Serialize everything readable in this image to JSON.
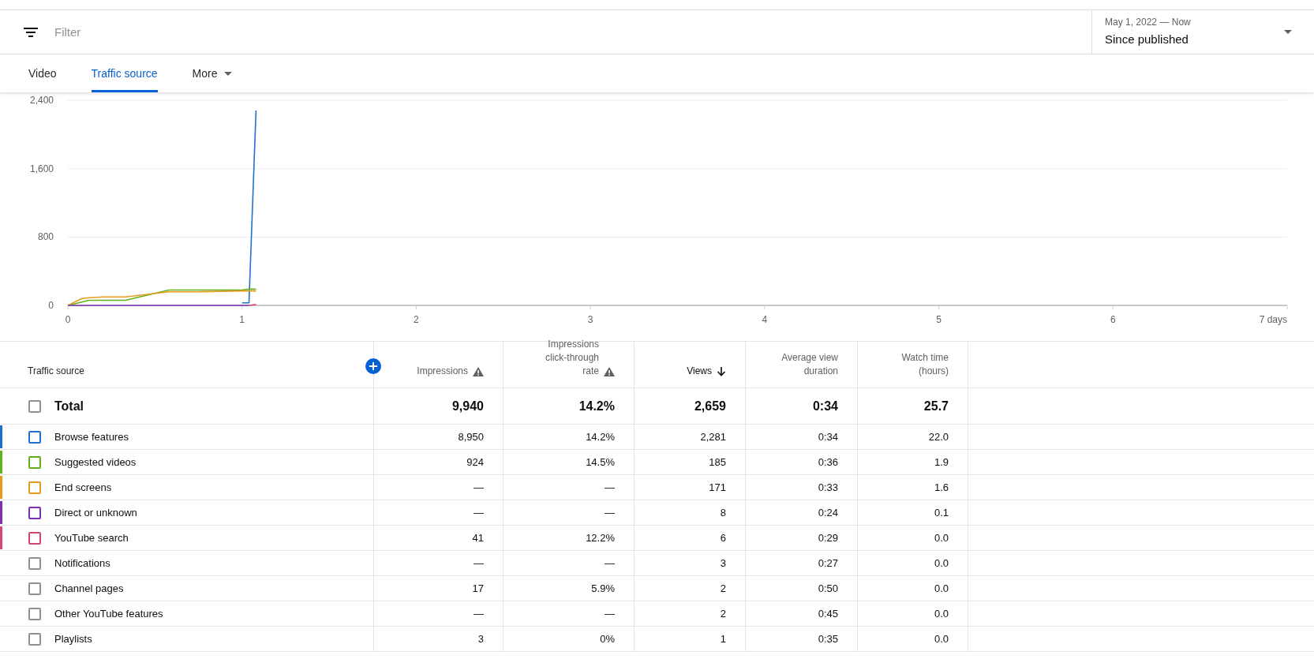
{
  "filter": {
    "placeholder": "Filter"
  },
  "date_range": {
    "range": "May 1, 2022 — Now",
    "label": "Since published"
  },
  "tabs": [
    {
      "label": "Video",
      "kind": "tab",
      "selected": false
    },
    {
      "label": "Traffic source",
      "kind": "tab",
      "selected": true
    },
    {
      "label": "More",
      "kind": "menu",
      "selected": false
    }
  ],
  "chart": {
    "chart_data": {
      "type": "line",
      "x": [
        0,
        0.08,
        0.12,
        0.2,
        0.33,
        0.58,
        0.75,
        1.0,
        1.04,
        1.08
      ],
      "series": [
        {
          "color": "#1f6fd1",
          "values": [
            null,
            null,
            null,
            null,
            null,
            null,
            null,
            30,
            30,
            2280
          ]
        },
        {
          "color": "#64b01a",
          "values": [
            0,
            40,
            60,
            60,
            60,
            180,
            180,
            180,
            190,
            190
          ]
        },
        {
          "color": "#e49b1c",
          "values": [
            0,
            80,
            90,
            100,
            100,
            160,
            160,
            170,
            170,
            170
          ]
        },
        {
          "color": "#7b2fb5",
          "values": [
            0,
            0,
            0,
            0,
            0,
            0,
            0,
            0,
            0,
            null
          ]
        },
        {
          "color": "#d6456b",
          "values": [
            null,
            null,
            null,
            null,
            null,
            null,
            null,
            null,
            0,
            10
          ]
        }
      ],
      "xlim": [
        0,
        7
      ],
      "ylim": [
        0,
        2400
      ],
      "xticks": [
        0,
        1,
        2,
        3,
        4,
        5,
        6,
        {
          "value": 7,
          "label": "7 days"
        }
      ],
      "yticks": [
        0,
        800,
        {
          "value": 1600,
          "label": "1,600"
        },
        {
          "value": 2400,
          "label": "2,400"
        }
      ]
    }
  },
  "table": {
    "columns": [
      {
        "label": "Traffic source",
        "kind": "name",
        "sorted": false
      },
      {
        "label": "Impressions",
        "kind": "flagged",
        "sorted": false
      },
      {
        "label": "Impressions click-through rate",
        "kind": "flagged",
        "sorted": false
      },
      {
        "label": "Views",
        "kind": "metric",
        "sorted": true
      },
      {
        "label": "Average view duration",
        "kind": "metric",
        "sorted": false
      },
      {
        "label": "Watch time (hours)",
        "kind": "metric",
        "sorted": false
      }
    ],
    "total": {
      "checked": false,
      "cells": [
        "Total",
        "9,940",
        "14.2%",
        "2,659",
        "0:34",
        "25.7"
      ]
    },
    "rows": [
      {
        "color": "#1f6fd1",
        "checked": false,
        "cells": [
          "Browse features",
          "8,950",
          "14.2%",
          "2,281",
          "0:34",
          "22.0"
        ]
      },
      {
        "color": "#64b01a",
        "checked": false,
        "cells": [
          "Suggested videos",
          "924",
          "14.5%",
          "185",
          "0:36",
          "1.9"
        ]
      },
      {
        "color": "#e49b1c",
        "checked": false,
        "cells": [
          "End screens",
          "—",
          "—",
          "171",
          "0:33",
          "1.6"
        ]
      },
      {
        "color": "#7b2fb5",
        "checked": false,
        "cells": [
          "Direct or unknown",
          "—",
          "—",
          "8",
          "0:24",
          "0.1"
        ]
      },
      {
        "color": "#d6456b",
        "checked": false,
        "cells": [
          "YouTube search",
          "41",
          "12.2%",
          "6",
          "0:29",
          "0.0"
        ]
      },
      {
        "checked": false,
        "cells": [
          "Notifications",
          "—",
          "—",
          "3",
          "0:27",
          "0.0"
        ]
      },
      {
        "checked": false,
        "cells": [
          "Channel pages",
          "17",
          "5.9%",
          "2",
          "0:50",
          "0.0"
        ]
      },
      {
        "checked": false,
        "cells": [
          "Other YouTube features",
          "—",
          "—",
          "2",
          "0:45",
          "0.0"
        ]
      },
      {
        "checked": false,
        "cells": [
          "Playlists",
          "3",
          "0%",
          "1",
          "0:35",
          "0.0"
        ]
      }
    ]
  }
}
